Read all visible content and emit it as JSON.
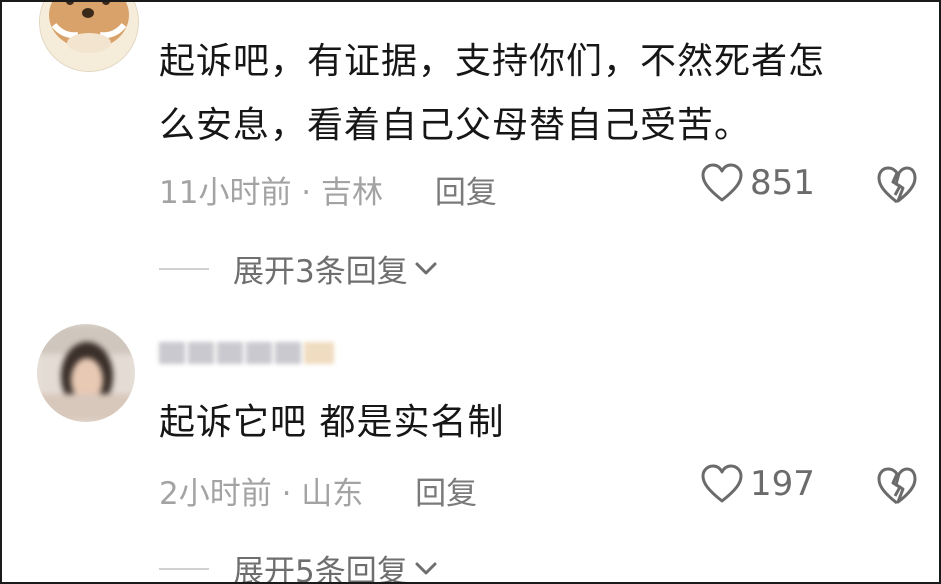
{
  "comments": [
    {
      "text_line1": "起诉吧，有证据，支持你们，不然死者怎",
      "text_line2": "么安息，看着自己父母替自己受苦。",
      "time_location": "11小时前 · 吉林",
      "reply_label": "回复",
      "like_count": "851",
      "expand_label": "展开3条回复"
    },
    {
      "text_line1": "起诉它吧  都是实名制",
      "time_location": "2小时前 · 山东",
      "reply_label": "回复",
      "like_count": "197",
      "expand_label": "展开5条回复"
    }
  ],
  "icons": {
    "like": "heart-outline-icon",
    "dislike": "broken-heart-icon",
    "expand": "chevron-down-icon"
  },
  "colors": {
    "text": "#161616",
    "meta": "#a3a3a3",
    "icon": "#6b6b6b"
  }
}
